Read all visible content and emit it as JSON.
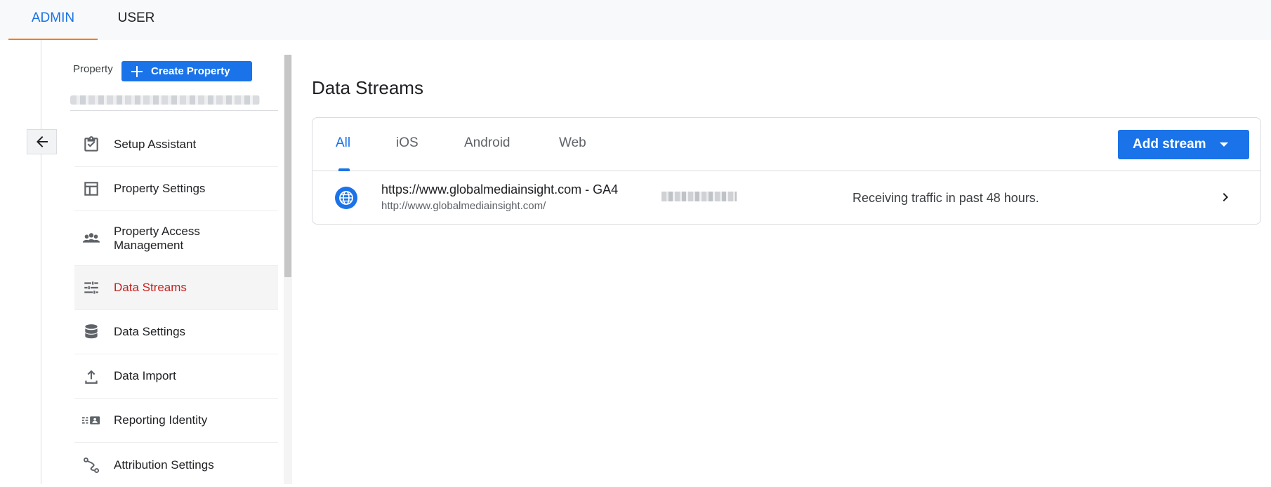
{
  "top_tabs": [
    {
      "label": "ADMIN",
      "active": true
    },
    {
      "label": "USER",
      "active": false
    }
  ],
  "property": {
    "label": "Property",
    "create_button": "Create Property"
  },
  "nav": {
    "items": [
      {
        "label": "Setup Assistant",
        "icon": "clipboard-check-icon"
      },
      {
        "label": "Property Settings",
        "icon": "layout-icon"
      },
      {
        "label": "Property Access Management",
        "icon": "people-icon"
      },
      {
        "label": "Data Streams",
        "icon": "streams-icon",
        "active": true
      },
      {
        "label": "Data Settings",
        "icon": "database-icon"
      },
      {
        "label": "Data Import",
        "icon": "upload-icon"
      },
      {
        "label": "Reporting Identity",
        "icon": "identity-icon"
      },
      {
        "label": "Attribution Settings",
        "icon": "attribution-icon"
      }
    ]
  },
  "main": {
    "title": "Data Streams",
    "tabs": [
      {
        "label": "All",
        "active": true
      },
      {
        "label": "iOS"
      },
      {
        "label": "Android"
      },
      {
        "label": "Web"
      }
    ],
    "add_stream_label": "Add stream",
    "streams": [
      {
        "name": "https://www.globalmediainsight.com - GA4",
        "url": "http://www.globalmediainsight.com/",
        "status": "Receiving traffic in past 48 hours.",
        "icon": "globe-icon"
      }
    ]
  },
  "colors": {
    "accent": "#1a73e8",
    "active_nav": "#c5221f",
    "tab_underline": "#fa7b17"
  }
}
